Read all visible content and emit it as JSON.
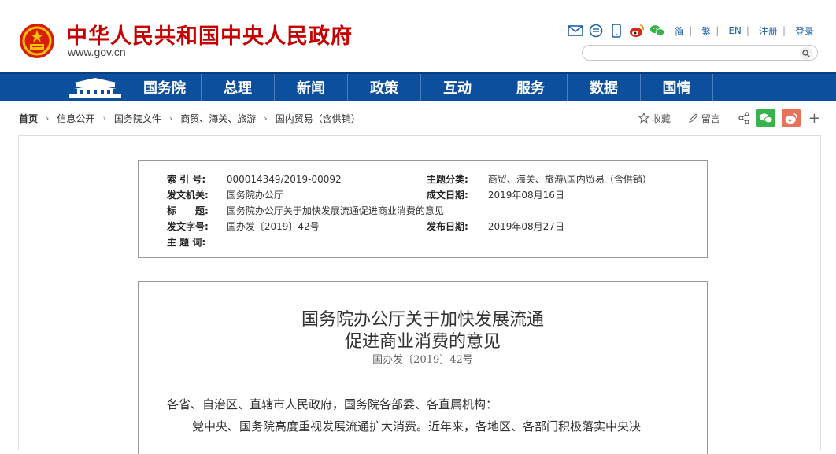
{
  "header": {
    "site_title": "中华人民共和国中央人民政府",
    "site_url": "www.gov.cn",
    "tools": {
      "icons": [
        "mail-icon",
        "message-icon",
        "mobile-icon",
        "weibo-icon",
        "wechat-icon"
      ],
      "lang_simplified": "简",
      "lang_traditional": "繁",
      "lang_english": "EN",
      "register": "注册",
      "login": "登录",
      "separator": "|"
    },
    "search": {
      "placeholder": ""
    }
  },
  "nav": {
    "items": [
      "国务院",
      "总理",
      "新闻",
      "政策",
      "互动",
      "服务",
      "数据",
      "国情"
    ]
  },
  "breadcrumb": {
    "home": "首页",
    "arrow": "›",
    "items": [
      "信息公开",
      "国务院文件",
      "商贸、海关、旅游",
      "国内贸易（含供销）"
    ]
  },
  "actions": {
    "favorite": "收藏",
    "comment": "留言"
  },
  "meta": {
    "index_label": "索 引 号:",
    "index_value": "000014349/2019-00092",
    "topic_label": "主题分类:",
    "topic_value": "商贸、海关、旅游\\国内贸易（含供销）",
    "issuer_label": "发文机关:",
    "issuer_value": "国务院办公厅",
    "written_label": "成文日期:",
    "written_value": "2019年08月16日",
    "title_label": "标　　题:",
    "title_value": "国务院办公厅关于加快发展流通促进商业消费的意见",
    "docno_label": "发文字号:",
    "docno_value": "国办发〔2019〕42号",
    "published_label": "发布日期:",
    "published_value": "2019年08月27日",
    "keywords_label": "主 题 词:",
    "keywords_value": ""
  },
  "document": {
    "title_line1": "国务院办公厅关于加快发展流通",
    "title_line2": "促进商业消费的意见",
    "doc_number": "国办发〔2019〕42号",
    "salutation": "各省、自治区、直辖市人民政府，国务院各部委、各直属机构：",
    "para1": "党中央、国务院高度重视发展流通扩大消费。近年来，各地区、各部门积极落实中央决"
  },
  "colors": {
    "brand_red": "#c40000",
    "nav_blue": "#0c4f9c",
    "link_blue": "#1f5fa6",
    "wechat_green": "#37b24d",
    "weibo_orange": "#e8735a"
  }
}
